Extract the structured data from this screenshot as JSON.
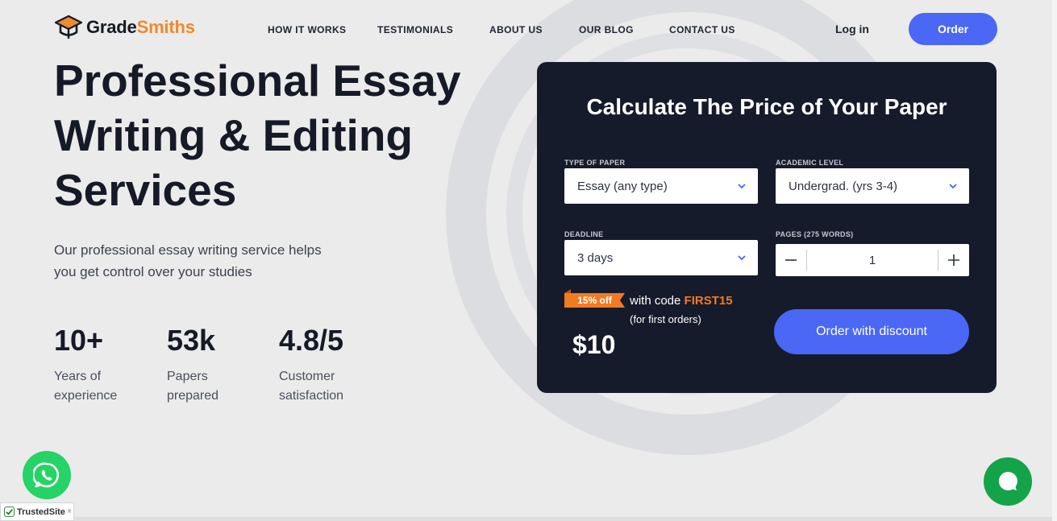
{
  "header": {
    "logo": {
      "part1": "Grade",
      "part2": "Smiths"
    },
    "nav": [
      "HOW IT WORKS",
      "TESTIMONIALS",
      "ABOUT US",
      "OUR BLOG",
      "CONTACT US"
    ],
    "login_label": "Log in",
    "order_label": "Order"
  },
  "hero": {
    "title": "Professional Essay Writing & Editing Services",
    "subtitle": "Our professional essay writing service helps you get control over your studies",
    "stats": [
      {
        "value": "10+",
        "label": "Years of experience"
      },
      {
        "value": "53k",
        "label": "Papers prepared"
      },
      {
        "value": "4.8/5",
        "label": "Customer satisfaction"
      }
    ]
  },
  "calculator": {
    "title": "Calculate The Price of Your Paper",
    "type_of_paper": {
      "label": "TYPE OF PAPER",
      "value": "Essay (any type)"
    },
    "academic_level": {
      "label": "ACADEMIC LEVEL",
      "value": "Undergrad. (yrs 3-4)"
    },
    "deadline": {
      "label": "DEADLINE",
      "value": "3 days"
    },
    "pages": {
      "label": "PAGES (275 WORDS)",
      "value": "1"
    },
    "promo": {
      "badge": "15% off",
      "text": "with code",
      "code": "FIRST15",
      "note": "(for first orders)"
    },
    "price": "$10",
    "discount_button": "Order with discount"
  },
  "widgets": {
    "trusted_site": "TrustedSite",
    "trusted_mark": "®"
  },
  "colors": {
    "accent": "#4a67f5",
    "brand_orange": "#f08a2b",
    "calc_bg": "#161b2b",
    "whatsapp": "#25d366",
    "chat": "#15a34a"
  },
  "icons": [
    "graduation-cap-logo-icon",
    "chevron-down-icon",
    "minus-icon",
    "plus-icon",
    "whatsapp-icon",
    "chat-bubble-icon",
    "check-shield-icon"
  ]
}
